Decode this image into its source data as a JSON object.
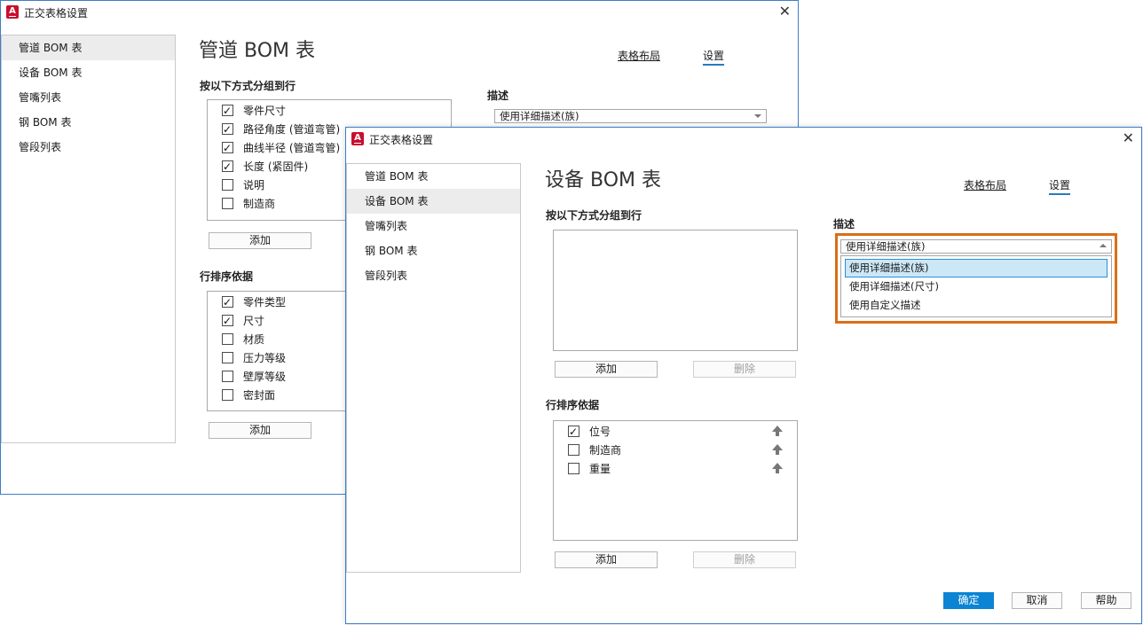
{
  "back_dialog": {
    "title": "正交表格设置",
    "heading": "管道 BOM 表",
    "nav": [
      "管道 BOM 表",
      "设备 BOM 表",
      "管嘴列表",
      "钢 BOM 表",
      "管段列表"
    ],
    "tabs": {
      "layout": "表格布局",
      "settings": "设置"
    },
    "group_label": "按以下方式分组到行",
    "group_items": [
      {
        "label": "零件尺寸",
        "checked": true
      },
      {
        "label": "路径角度 (管道弯管)",
        "checked": true
      },
      {
        "label": "曲线半径 (管道弯管)",
        "checked": true
      },
      {
        "label": "长度 (紧固件)",
        "checked": true
      },
      {
        "label": "说明",
        "checked": false
      },
      {
        "label": "制造商",
        "checked": false
      }
    ],
    "add_label": "添加",
    "sort_label": "行排序依据",
    "sort_items": [
      {
        "label": "零件类型",
        "checked": true
      },
      {
        "label": "尺寸",
        "checked": true
      },
      {
        "label": "材质",
        "checked": false
      },
      {
        "label": "压力等级",
        "checked": false
      },
      {
        "label": "壁厚等级",
        "checked": false
      },
      {
        "label": "密封面",
        "checked": false
      }
    ],
    "description_label": "描述",
    "description_value": "使用详细描述(族)"
  },
  "front_dialog": {
    "title": "正交表格设置",
    "heading": "设备 BOM 表",
    "nav": [
      "管道 BOM 表",
      "设备 BOM 表",
      "管嘴列表",
      "钢 BOM 表",
      "管段列表"
    ],
    "tabs": {
      "layout": "表格布局",
      "settings": "设置"
    },
    "group_label": "按以下方式分组到行",
    "add_label": "添加",
    "delete_label": "删除",
    "sort_label": "行排序依据",
    "sort_items": [
      {
        "label": "位号",
        "checked": true
      },
      {
        "label": "制造商",
        "checked": false
      },
      {
        "label": "重量",
        "checked": false
      }
    ],
    "description_label": "描述",
    "description_value": "使用详细描述(族)",
    "description_options": [
      "使用详细描述(族)",
      "使用详细描述(尺寸)",
      "使用自定义描述"
    ],
    "ok_label": "确定",
    "cancel_label": "取消",
    "help_label": "帮助"
  },
  "colors": {
    "accent": "#0a84d3",
    "highlight": "#d86f17",
    "selection": "#cce8f7"
  }
}
